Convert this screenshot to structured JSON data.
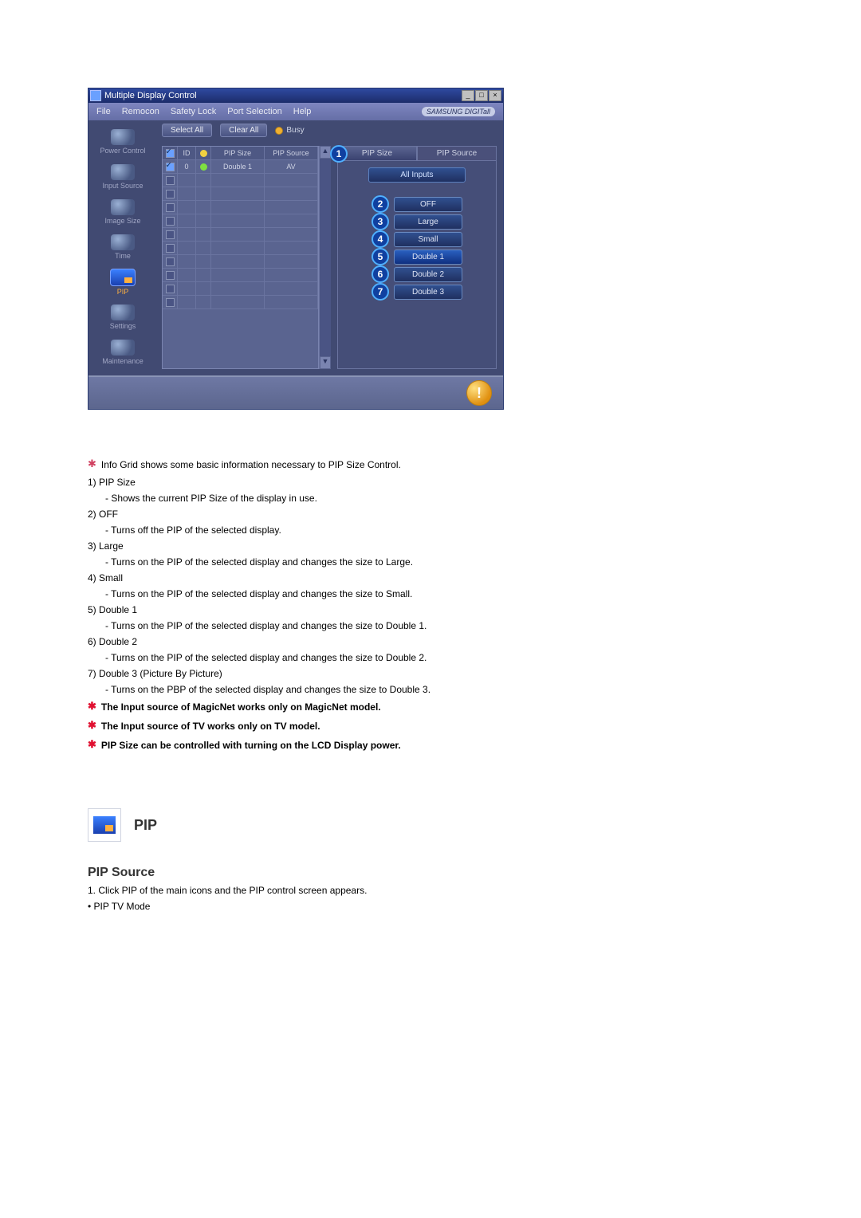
{
  "app": {
    "title": "Multiple Display Control",
    "menus": [
      "File",
      "Remocon",
      "Safety Lock",
      "Port Selection",
      "Help"
    ],
    "brand": "SAMSUNG DIGITall",
    "window_buttons": {
      "min": "_",
      "max": "□",
      "close": "×"
    }
  },
  "toolbar": {
    "select_all": "Select All",
    "clear_all": "Clear All",
    "busy": "Busy"
  },
  "sidebar": {
    "items": [
      {
        "label": "Power Control"
      },
      {
        "label": "Input Source"
      },
      {
        "label": "Image Size"
      },
      {
        "label": "Time"
      },
      {
        "label": "PIP"
      },
      {
        "label": "Settings"
      },
      {
        "label": "Maintenance"
      }
    ]
  },
  "table": {
    "headers": {
      "chk": "☑",
      "id": "ID",
      "pwr": "⏻",
      "size": "PIP Size",
      "src": "PIP Source"
    },
    "rows": [
      {
        "checked": true,
        "id": "0",
        "power": "on",
        "size": "Double 1",
        "src": "AV"
      },
      {
        "checked": false,
        "id": "",
        "power": "",
        "size": "",
        "src": ""
      },
      {
        "checked": false,
        "id": "",
        "power": "",
        "size": "",
        "src": ""
      },
      {
        "checked": false,
        "id": "",
        "power": "",
        "size": "",
        "src": ""
      },
      {
        "checked": false,
        "id": "",
        "power": "",
        "size": "",
        "src": ""
      },
      {
        "checked": false,
        "id": "",
        "power": "",
        "size": "",
        "src": ""
      },
      {
        "checked": false,
        "id": "",
        "power": "",
        "size": "",
        "src": ""
      },
      {
        "checked": false,
        "id": "",
        "power": "",
        "size": "",
        "src": ""
      },
      {
        "checked": false,
        "id": "",
        "power": "",
        "size": "",
        "src": ""
      },
      {
        "checked": false,
        "id": "",
        "power": "",
        "size": "",
        "src": ""
      },
      {
        "checked": false,
        "id": "",
        "power": "",
        "size": "",
        "src": ""
      }
    ]
  },
  "right_panel": {
    "tabs": [
      {
        "label": "PIP Size",
        "badge": "1",
        "active": true
      },
      {
        "label": "PIP Source",
        "active": false
      }
    ],
    "header": "All Inputs",
    "options": [
      {
        "badge": "2",
        "label": "OFF"
      },
      {
        "badge": "3",
        "label": "Large"
      },
      {
        "badge": "4",
        "label": "Small"
      },
      {
        "badge": "5",
        "label": "Double 1"
      },
      {
        "badge": "6",
        "label": "Double 2"
      },
      {
        "badge": "7",
        "label": "Double 3"
      }
    ]
  },
  "statusbar": {
    "orb": "!"
  },
  "doc": {
    "intro_star": "Info Grid shows some basic information necessary to PIP Size Control.",
    "items": [
      {
        "num": "1)",
        "title": "PIP Size",
        "desc": "- Shows the current PIP Size of the display in use."
      },
      {
        "num": "2)",
        "title": "OFF",
        "desc": "- Turns off the PIP of the selected display."
      },
      {
        "num": "3)",
        "title": "Large",
        "desc": "- Turns on the PIP of the selected display and changes the size to Large."
      },
      {
        "num": "4)",
        "title": "Small",
        "desc": "- Turns on the PIP of the selected display and changes the size to Small."
      },
      {
        "num": "5)",
        "title": "Double 1",
        "desc": "- Turns on the PIP of the selected display and changes the size to Double 1."
      },
      {
        "num": "6)",
        "title": "Double 2",
        "desc": "- Turns on the PIP of the selected display and changes the size to Double 2."
      },
      {
        "num": "7)",
        "title": "Double 3 (Picture By Picture)",
        "desc": "- Turns on the PBP of the selected display and changes the size to Double 3."
      }
    ],
    "notes": [
      "The Input source of MagicNet works only on MagicNet model.",
      "The Input source of TV works only on TV model.",
      "PIP Size can be controlled with turning on the LCD Display power."
    ],
    "section_title": "PIP",
    "subheading": "PIP Source",
    "step1": "1. Click PIP of the main icons and the PIP control screen appears.",
    "bullet": "• PIP TV Mode"
  }
}
